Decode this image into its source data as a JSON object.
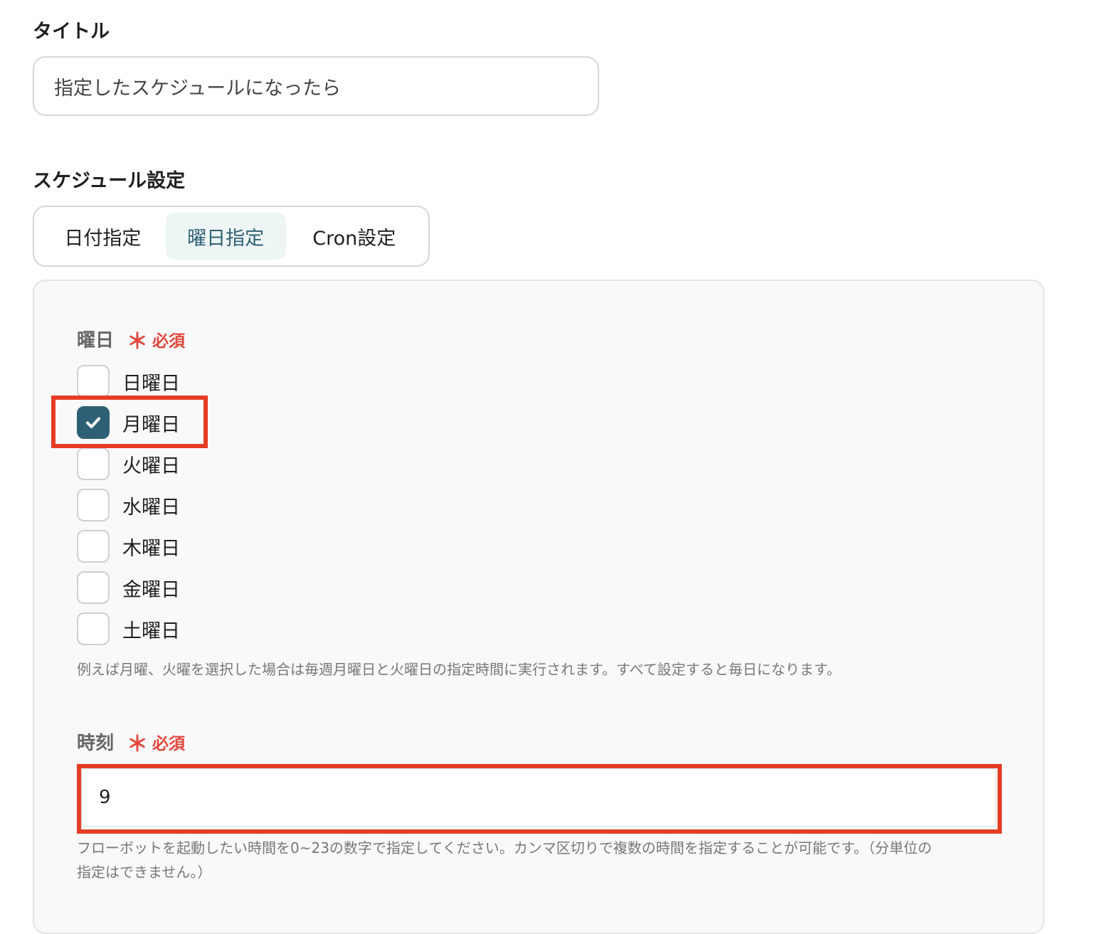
{
  "title_field": {
    "label": "タイトル",
    "value": "指定したスケジュールになったら"
  },
  "schedule": {
    "label": "スケジュール設定",
    "tabs": [
      {
        "label": "日付指定",
        "active": false
      },
      {
        "label": "曜日指定",
        "active": true
      },
      {
        "label": "Cron設定",
        "active": false
      }
    ]
  },
  "weekday": {
    "label": "曜日",
    "required_mark": "＊",
    "required_text": "必須",
    "options": [
      {
        "label": "日曜日",
        "checked": false
      },
      {
        "label": "月曜日",
        "checked": true
      },
      {
        "label": "火曜日",
        "checked": false
      },
      {
        "label": "水曜日",
        "checked": false
      },
      {
        "label": "木曜日",
        "checked": false
      },
      {
        "label": "金曜日",
        "checked": false
      },
      {
        "label": "土曜日",
        "checked": false
      }
    ],
    "hint": "例えば月曜、火曜を選択した場合は毎週月曜日と火曜日の指定時間に実行されます。すべて設定すると毎日になります。"
  },
  "time": {
    "label": "時刻",
    "required_mark": "＊",
    "required_text": "必須",
    "value": "9",
    "hint_line1": "フローボットを起動したい時間を0~23の数字で指定してください。カンマ区切りで複数の時間を指定することが可能です。（分単位の",
    "hint_line2": "指定はできません。）"
  },
  "colors": {
    "accent": "#2e6075",
    "required": "#e2463c",
    "highlight": "#e43d24"
  }
}
